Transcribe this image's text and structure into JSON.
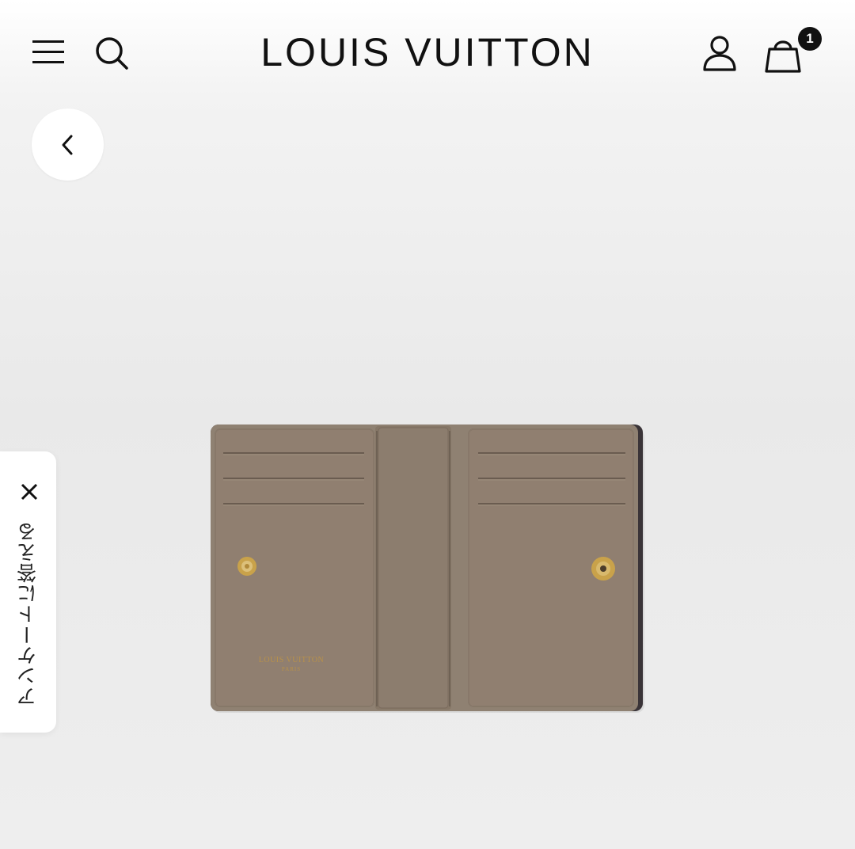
{
  "header": {
    "brand": "LOUIS VUITTON",
    "cart_count": "1",
    "icons": {
      "menu": "hamburger-menu-icon",
      "search": "search-icon",
      "account": "user-icon",
      "cart": "shopping-bag-icon"
    }
  },
  "navigation": {
    "back_icon": "chevron-left-icon"
  },
  "survey": {
    "label": "アンケートに答える",
    "close_icon": "close-icon"
  },
  "product_image": {
    "stamp_brand": "LOUIS VUITTON",
    "stamp_city": "PARIS"
  },
  "colors": {
    "leather": "#8f8172",
    "leather_dark": "#7b6d60",
    "gold": "#c9a24a",
    "text": "#111111"
  }
}
